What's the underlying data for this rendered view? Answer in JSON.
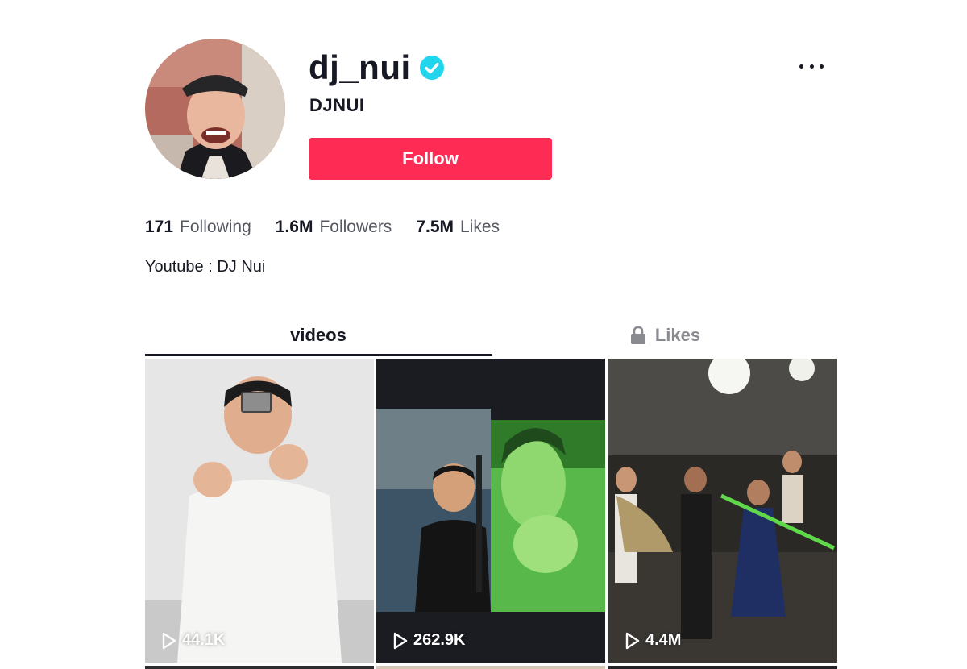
{
  "profile": {
    "username": "dj_nui",
    "nickname": "DJNUI",
    "verified": true,
    "follow_label": "Follow",
    "bio": "Youtube : DJ Nui"
  },
  "stats": {
    "following": {
      "value": "171",
      "label": "Following"
    },
    "followers": {
      "value": "1.6M",
      "label": "Followers"
    },
    "likes": {
      "value": "7.5M",
      "label": "Likes"
    }
  },
  "tabs": [
    {
      "label": "videos",
      "active": true
    },
    {
      "label": "Likes",
      "active": false,
      "locked": true
    }
  ],
  "videos": [
    {
      "views": "44.1K"
    },
    {
      "views": "262.9K"
    },
    {
      "views": "4.4M"
    }
  ],
  "colors": {
    "accent": "#fe2c55",
    "verified": "#20d5ec",
    "text": "#161823",
    "muted": "#8a8b91"
  }
}
